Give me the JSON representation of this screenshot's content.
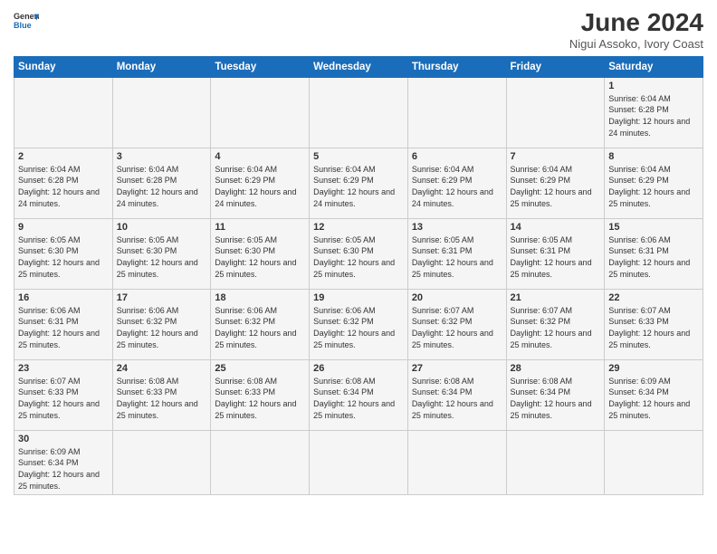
{
  "logo": {
    "general": "General",
    "blue": "Blue"
  },
  "header": {
    "month": "June 2024",
    "location": "Nigui Assoko, Ivory Coast"
  },
  "days_of_week": [
    "Sunday",
    "Monday",
    "Tuesday",
    "Wednesday",
    "Thursday",
    "Friday",
    "Saturday"
  ],
  "weeks": [
    [
      {
        "day": "",
        "info": ""
      },
      {
        "day": "",
        "info": ""
      },
      {
        "day": "",
        "info": ""
      },
      {
        "day": "",
        "info": ""
      },
      {
        "day": "",
        "info": ""
      },
      {
        "day": "",
        "info": ""
      },
      {
        "day": "1",
        "info": "Sunrise: 6:04 AM\nSunset: 6:28 PM\nDaylight: 12 hours and 24 minutes."
      }
    ],
    [
      {
        "day": "2",
        "info": "Sunrise: 6:04 AM\nSunset: 6:28 PM\nDaylight: 12 hours and 24 minutes."
      },
      {
        "day": "3",
        "info": "Sunrise: 6:04 AM\nSunset: 6:28 PM\nDaylight: 12 hours and 24 minutes."
      },
      {
        "day": "4",
        "info": "Sunrise: 6:04 AM\nSunset: 6:29 PM\nDaylight: 12 hours and 24 minutes."
      },
      {
        "day": "5",
        "info": "Sunrise: 6:04 AM\nSunset: 6:29 PM\nDaylight: 12 hours and 24 minutes."
      },
      {
        "day": "6",
        "info": "Sunrise: 6:04 AM\nSunset: 6:29 PM\nDaylight: 12 hours and 24 minutes."
      },
      {
        "day": "7",
        "info": "Sunrise: 6:04 AM\nSunset: 6:29 PM\nDaylight: 12 hours and 25 minutes."
      },
      {
        "day": "8",
        "info": "Sunrise: 6:04 AM\nSunset: 6:29 PM\nDaylight: 12 hours and 25 minutes."
      }
    ],
    [
      {
        "day": "9",
        "info": "Sunrise: 6:05 AM\nSunset: 6:30 PM\nDaylight: 12 hours and 25 minutes."
      },
      {
        "day": "10",
        "info": "Sunrise: 6:05 AM\nSunset: 6:30 PM\nDaylight: 12 hours and 25 minutes."
      },
      {
        "day": "11",
        "info": "Sunrise: 6:05 AM\nSunset: 6:30 PM\nDaylight: 12 hours and 25 minutes."
      },
      {
        "day": "12",
        "info": "Sunrise: 6:05 AM\nSunset: 6:30 PM\nDaylight: 12 hours and 25 minutes."
      },
      {
        "day": "13",
        "info": "Sunrise: 6:05 AM\nSunset: 6:31 PM\nDaylight: 12 hours and 25 minutes."
      },
      {
        "day": "14",
        "info": "Sunrise: 6:05 AM\nSunset: 6:31 PM\nDaylight: 12 hours and 25 minutes."
      },
      {
        "day": "15",
        "info": "Sunrise: 6:06 AM\nSunset: 6:31 PM\nDaylight: 12 hours and 25 minutes."
      }
    ],
    [
      {
        "day": "16",
        "info": "Sunrise: 6:06 AM\nSunset: 6:31 PM\nDaylight: 12 hours and 25 minutes."
      },
      {
        "day": "17",
        "info": "Sunrise: 6:06 AM\nSunset: 6:32 PM\nDaylight: 12 hours and 25 minutes."
      },
      {
        "day": "18",
        "info": "Sunrise: 6:06 AM\nSunset: 6:32 PM\nDaylight: 12 hours and 25 minutes."
      },
      {
        "day": "19",
        "info": "Sunrise: 6:06 AM\nSunset: 6:32 PM\nDaylight: 12 hours and 25 minutes."
      },
      {
        "day": "20",
        "info": "Sunrise: 6:07 AM\nSunset: 6:32 PM\nDaylight: 12 hours and 25 minutes."
      },
      {
        "day": "21",
        "info": "Sunrise: 6:07 AM\nSunset: 6:32 PM\nDaylight: 12 hours and 25 minutes."
      },
      {
        "day": "22",
        "info": "Sunrise: 6:07 AM\nSunset: 6:33 PM\nDaylight: 12 hours and 25 minutes."
      }
    ],
    [
      {
        "day": "23",
        "info": "Sunrise: 6:07 AM\nSunset: 6:33 PM\nDaylight: 12 hours and 25 minutes."
      },
      {
        "day": "24",
        "info": "Sunrise: 6:08 AM\nSunset: 6:33 PM\nDaylight: 12 hours and 25 minutes."
      },
      {
        "day": "25",
        "info": "Sunrise: 6:08 AM\nSunset: 6:33 PM\nDaylight: 12 hours and 25 minutes."
      },
      {
        "day": "26",
        "info": "Sunrise: 6:08 AM\nSunset: 6:34 PM\nDaylight: 12 hours and 25 minutes."
      },
      {
        "day": "27",
        "info": "Sunrise: 6:08 AM\nSunset: 6:34 PM\nDaylight: 12 hours and 25 minutes."
      },
      {
        "day": "28",
        "info": "Sunrise: 6:08 AM\nSunset: 6:34 PM\nDaylight: 12 hours and 25 minutes."
      },
      {
        "day": "29",
        "info": "Sunrise: 6:09 AM\nSunset: 6:34 PM\nDaylight: 12 hours and 25 minutes."
      }
    ],
    [
      {
        "day": "30",
        "info": "Sunrise: 6:09 AM\nSunset: 6:34 PM\nDaylight: 12 hours and 25 minutes."
      },
      {
        "day": "",
        "info": ""
      },
      {
        "day": "",
        "info": ""
      },
      {
        "day": "",
        "info": ""
      },
      {
        "day": "",
        "info": ""
      },
      {
        "day": "",
        "info": ""
      },
      {
        "day": "",
        "info": ""
      }
    ]
  ]
}
